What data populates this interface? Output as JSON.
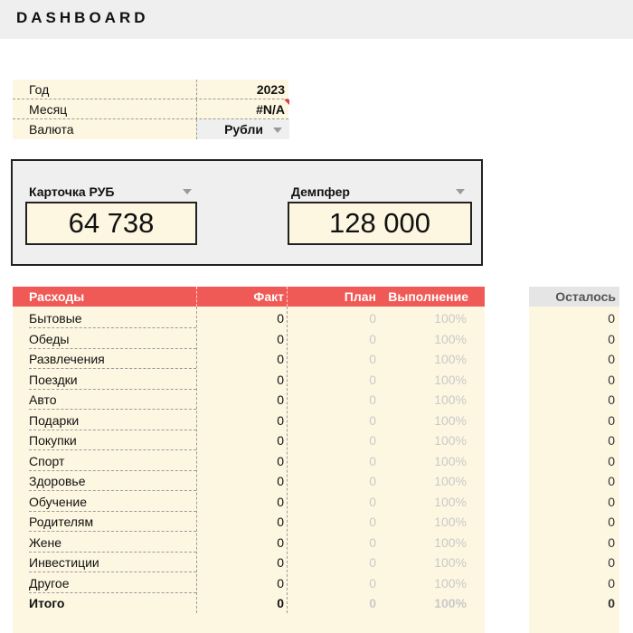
{
  "title": "DASHBOARD",
  "params": {
    "year_label": "Год",
    "year_value": "2023",
    "month_label": "Месяц",
    "month_value": "#N/A",
    "currency_label": "Валюта",
    "currency_value": "Рубли"
  },
  "cards": {
    "left_label": "Карточка РУБ",
    "left_value": "64 738",
    "right_label": "Демпфер",
    "right_value": "128 000"
  },
  "table": {
    "headers": {
      "name": "Расходы",
      "fact": "Факт",
      "plan": "План",
      "completion": "Выполнение",
      "remaining": "Осталось"
    },
    "rows": [
      {
        "name": "Бытовые",
        "fact": "0",
        "plan": "0",
        "completion": "100%",
        "remaining": "0"
      },
      {
        "name": "Обеды",
        "fact": "0",
        "plan": "0",
        "completion": "100%",
        "remaining": "0"
      },
      {
        "name": "Развлечения",
        "fact": "0",
        "plan": "0",
        "completion": "100%",
        "remaining": "0"
      },
      {
        "name": "Поездки",
        "fact": "0",
        "plan": "0",
        "completion": "100%",
        "remaining": "0"
      },
      {
        "name": "Авто",
        "fact": "0",
        "plan": "0",
        "completion": "100%",
        "remaining": "0"
      },
      {
        "name": "Подарки",
        "fact": "0",
        "plan": "0",
        "completion": "100%",
        "remaining": "0"
      },
      {
        "name": "Покупки",
        "fact": "0",
        "plan": "0",
        "completion": "100%",
        "remaining": "0"
      },
      {
        "name": "Спорт",
        "fact": "0",
        "plan": "0",
        "completion": "100%",
        "remaining": "0"
      },
      {
        "name": "Здоровье",
        "fact": "0",
        "plan": "0",
        "completion": "100%",
        "remaining": "0"
      },
      {
        "name": "Обучение",
        "fact": "0",
        "plan": "0",
        "completion": "100%",
        "remaining": "0"
      },
      {
        "name": "Родителям",
        "fact": "0",
        "plan": "0",
        "completion": "100%",
        "remaining": "0"
      },
      {
        "name": "Жене",
        "fact": "0",
        "plan": "0",
        "completion": "100%",
        "remaining": "0"
      },
      {
        "name": "Инвестиции",
        "fact": "0",
        "plan": "0",
        "completion": "100%",
        "remaining": "0"
      },
      {
        "name": "Другое",
        "fact": "0",
        "plan": "0",
        "completion": "100%",
        "remaining": "0"
      }
    ],
    "total": {
      "name": "Итого",
      "fact": "0",
      "plan": "0",
      "completion": "100%",
      "remaining": "0"
    }
  },
  "colors": {
    "header_red": "#f05a56",
    "cell_yellow": "#fdf7e1",
    "panel_grey": "#efefef"
  }
}
